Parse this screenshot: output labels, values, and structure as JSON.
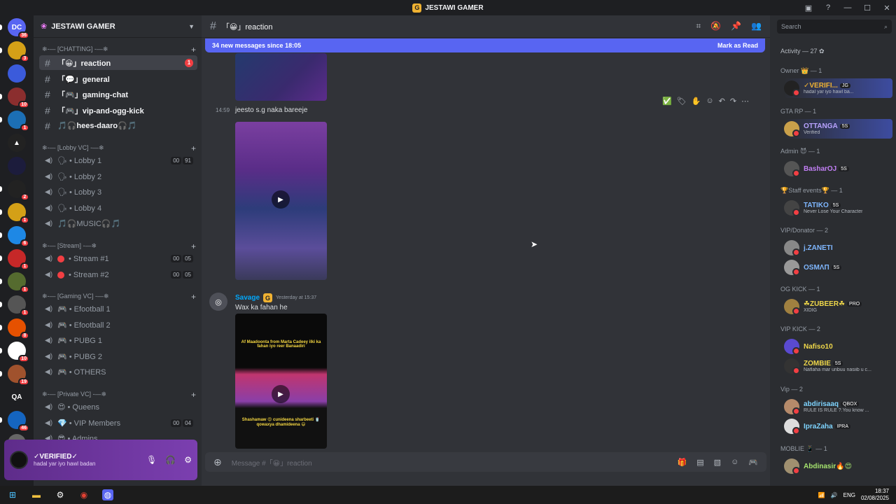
{
  "window": {
    "title": "JESTAWI GAMER"
  },
  "servers": [
    {
      "label": "DC",
      "badge": "36",
      "color": "#5865f2"
    },
    {
      "label": "",
      "badge": "3",
      "color": "#d4a017"
    },
    {
      "label": "",
      "badge": "",
      "color": "#3b5bdb"
    },
    {
      "label": "",
      "badge": "10",
      "color": "#8b2e2e"
    },
    {
      "label": "",
      "badge": "1",
      "color": "#1c6fb5"
    },
    {
      "label": "▲",
      "badge": "",
      "color": "#222"
    },
    {
      "label": "",
      "badge": "",
      "color": "#1c1c3c"
    },
    {
      "label": "",
      "badge": "2",
      "color": "#222"
    },
    {
      "label": "",
      "badge": "1",
      "color": "#d4a017"
    },
    {
      "label": "",
      "badge": "6",
      "color": "#1e88e5"
    },
    {
      "label": "",
      "badge": "1",
      "color": "#c62828"
    },
    {
      "label": "",
      "badge": "1",
      "color": "#556b2f"
    },
    {
      "label": "",
      "badge": "1",
      "color": "#555"
    },
    {
      "label": "",
      "badge": "8",
      "color": "#e65100"
    },
    {
      "label": "",
      "badge": "10",
      "color": "#fff"
    },
    {
      "label": "",
      "badge": "19",
      "color": "#a0522d"
    },
    {
      "label": "QA",
      "badge": "",
      "color": "#1e1f22"
    },
    {
      "label": "",
      "badge": "46",
      "color": "#1565c0"
    },
    {
      "label": "",
      "badge": "",
      "color": "#666"
    }
  ],
  "server_new": "NEW",
  "guild": {
    "name": "JESTAWI GAMER"
  },
  "categories": {
    "chatting": "❄-— [CHATTING] -—❄",
    "lobby": "❄-— [Lobby VC] -—❄",
    "stream": "❄-— [Stream] -—❄",
    "gaming": "❄-— [Gaming VC] -—❄",
    "private": "❄-— [Private VC] -—❄"
  },
  "channels": {
    "reaction": "「😀」reaction",
    "reaction_badge": "1",
    "general": "「💬」general",
    "gaming_chat": "「🎮」gaming-chat",
    "vip": "「🎮」vip-and-ogg-kick",
    "hees": "🎵🎧hees-daaro🎧🎵",
    "lobby1": "🗣 • Lobby 1",
    "lobby1_a": "00",
    "lobby1_b": "91",
    "lobby2": "🗣 • Lobby 2",
    "lobby3": "🗣 • Lobby 3",
    "lobby4": "🗣 • Lobby 4",
    "music": "🎵🎧MUSIC🎧🎵",
    "stream1": "• Stream #1",
    "stream1_a": "00",
    "stream1_b": "05",
    "stream2": "• Stream #2",
    "stream2_a": "00",
    "stream2_b": "05",
    "ef1": "🎮 • Efootball 1",
    "ef2": "🎮 • Efootball 2",
    "pubg1": "🎮 • PUBG 1",
    "pubg2": "🎮 • PUBG 2",
    "others": "🎮 • OTHERS",
    "queens": "😍 • Queens",
    "vip_members": "💎 • VIP Members",
    "vip_a": "00",
    "vip_b": "04",
    "admins": "😎 • Admins"
  },
  "user": {
    "name": "✓VERIFIED✓",
    "status": "hadal yar iyo hawl badan"
  },
  "chat": {
    "channel": "「😀」reaction",
    "new_messages": "34 new messages since 18:05",
    "mark_read": "Mark as Read",
    "msg1_time": "14:59",
    "msg1_text": "jeesto s.g naka bareeje",
    "msg2_author": "Savage",
    "msg2_time": "Yesterday at 15:37",
    "msg2_text": "Wax ka fahan he",
    "placeholder": "Message #「😀」reaction",
    "video_caption": "Af Maadoonta from Marta Cadeey ilki ka fahan iyo reer Banaadiri",
    "video_caption2": "Shashamaw 😍 cunideena sharbeeti 🥤 qowaxya dhamideena 😄"
  },
  "members": {
    "search_placeholder": "Search",
    "activity": "Activity — 27",
    "groups": [
      {
        "label": "Owner 👑 — 1"
      },
      {
        "label": "GTA RP — 1"
      },
      {
        "label": "Admin 😈 — 1"
      },
      {
        "label": "🏆Staff events🏆 — 1"
      },
      {
        "label": "VIP/Donator — 2"
      },
      {
        "label": "OG KICK — 1"
      },
      {
        "label": "VIP KICK — 2"
      },
      {
        "label": "Vip — 2"
      },
      {
        "label": "MOBLIE 📱 — 1"
      }
    ],
    "list": [
      {
        "name": "✓VERIFI...",
        "tag": "JG",
        "sub": "hadal yar iyo hawl ba...",
        "color": "#f0b232"
      },
      {
        "name": "OTTANGA",
        "tag": "5S",
        "sub": "Verified",
        "color": "#b9a3ff"
      },
      {
        "name": "BasharOJ",
        "tag": "5S",
        "sub": "",
        "color": "#c27ff5"
      },
      {
        "name": "TATIKO",
        "tag": "5S",
        "sub": "Never Lose Your Character",
        "color": "#7fb7ff"
      },
      {
        "name": "j.ZANETI",
        "tag": "",
        "sub": "",
        "color": "#7fb7ff"
      },
      {
        "name": "OSMΛП",
        "tag": "5S",
        "sub": "",
        "color": "#7fb7ff"
      },
      {
        "name": "☘ZUBEER☘",
        "tag": "PRO",
        "sub": "XIDIG",
        "color": "#f0d84a"
      },
      {
        "name": "Nafiso10",
        "tag": "",
        "sub": "",
        "color": "#f0d84a"
      },
      {
        "name": "ZOMBIE",
        "tag": "5S",
        "sub": "Naflaha mar unbuu nasiib u c...",
        "color": "#f0d84a"
      },
      {
        "name": "abdirisaaq",
        "tag": "QBOX",
        "sub": "RULE IS RULE ?.You know ...",
        "color": "#7ed4ff"
      },
      {
        "name": "IpraZaha",
        "tag": "IPRA",
        "sub": "",
        "color": "#7ed4ff"
      },
      {
        "name": "Abdinasir🔥😍",
        "tag": "",
        "sub": "",
        "color": "#a5e36e"
      }
    ]
  },
  "taskbar": {
    "lang": "ENG",
    "time": "18:37",
    "date": "02/08/2025"
  }
}
